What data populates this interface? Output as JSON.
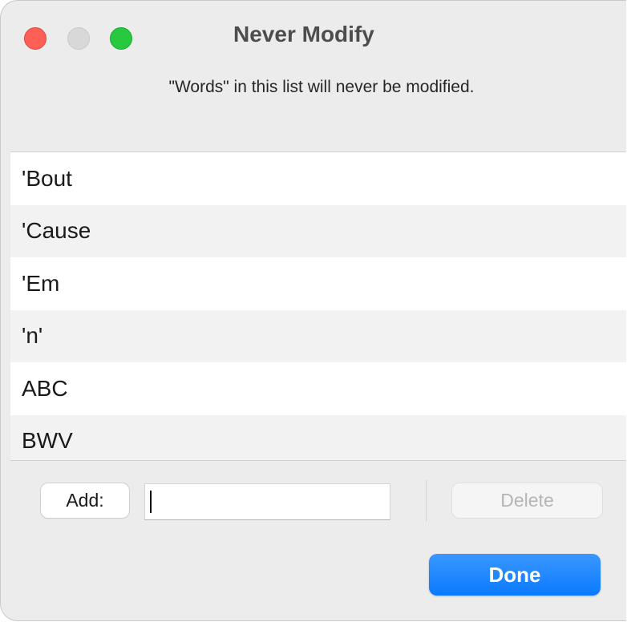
{
  "window": {
    "title": "Never Modify",
    "description": "\"Words\" in this list will never be modified."
  },
  "list": {
    "items": [
      {
        "label": "'Bout"
      },
      {
        "label": "'Cause"
      },
      {
        "label": "'Em"
      },
      {
        "label": "'n'"
      },
      {
        "label": "ABC"
      },
      {
        "label": "BWV"
      }
    ]
  },
  "controls": {
    "add_label": "Add:",
    "add_input_value": "",
    "delete_label": "Delete",
    "done_label": "Done"
  },
  "colors": {
    "close": "#fe5f57",
    "minimize_disabled": "#d8d8d8",
    "zoom": "#28c840",
    "accent": "#0a7aff"
  },
  "icons": [
    "close-traffic-light",
    "minimize-traffic-light",
    "zoom-traffic-light"
  ]
}
